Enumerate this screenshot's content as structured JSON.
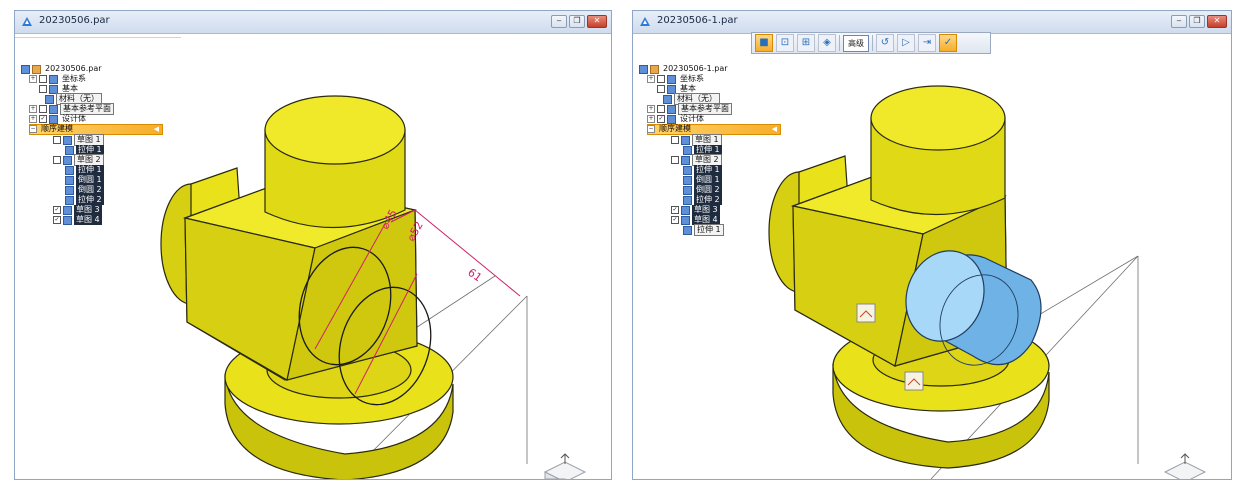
{
  "windows": [
    {
      "title": "20230506.par",
      "tree": [
        {
          "label": "20230506.par"
        },
        {
          "label": "坐标系"
        },
        {
          "label": "基本"
        },
        {
          "label": "材料（无）"
        },
        {
          "label": "基本参考平面"
        },
        {
          "label": "设计体"
        },
        {
          "label": "顺序建模"
        },
        {
          "label": "草图 1"
        },
        {
          "label": "拉伸 1"
        },
        {
          "label": "草图 2"
        },
        {
          "label": "拉伸 1"
        },
        {
          "label": "倒圆 1"
        },
        {
          "label": "倒圆 2"
        },
        {
          "label": "拉伸 2"
        },
        {
          "label": "草图 3"
        },
        {
          "label": "草图 4"
        }
      ],
      "dimensions": {
        "d1": "⌀45",
        "d2": "⌀52",
        "d3": "61"
      }
    },
    {
      "title": "20230506-1.par",
      "tree": [
        {
          "label": "20230506-1.par"
        },
        {
          "label": "坐标系"
        },
        {
          "label": "基本"
        },
        {
          "label": "材料（无）"
        },
        {
          "label": "基本参考平面"
        },
        {
          "label": "设计体"
        },
        {
          "label": "顺序建模"
        },
        {
          "label": "草图 1"
        },
        {
          "label": "拉伸 1"
        },
        {
          "label": "草图 2"
        },
        {
          "label": "拉伸 1"
        },
        {
          "label": "倒圆 1"
        },
        {
          "label": "倒圆 2"
        },
        {
          "label": "拉伸 2"
        },
        {
          "label": "草图 3"
        },
        {
          "label": "草图 4"
        },
        {
          "label": "拉伸 1"
        }
      ],
      "toolbar": {
        "text_button": "高级"
      }
    }
  ],
  "window_buttons": {
    "minimize": "‒",
    "restore": "❐",
    "close": "✕"
  },
  "colors": {
    "part_yellow": "#e9e21a",
    "edge": "#2a2a10",
    "extrude_blue": "#8ec6ee",
    "dimension_magenta": "#d0206a",
    "highlight_orange": "#f6ad2a"
  },
  "icons": [
    "app-icon",
    "expand-icon",
    "checkbox-icon",
    "sketch-icon",
    "feature-icon",
    "view-cube-icon",
    "handle-icon"
  ]
}
